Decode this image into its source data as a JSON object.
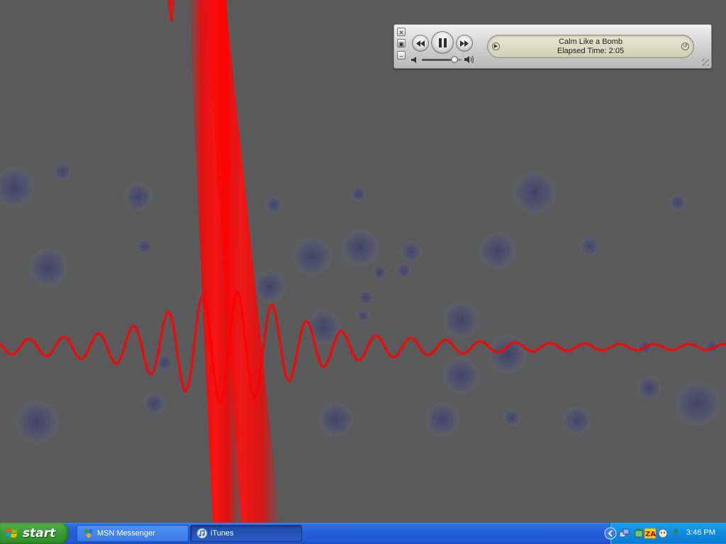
{
  "player": {
    "track_title": "Calm Like a Bomb",
    "elapsed_text": "Elapsed Time: 2:05",
    "volume_level": 0.82,
    "window_buttons": {
      "close": "close-icon",
      "zoom": "zoom-icon",
      "minimize": "minimize-icon"
    },
    "controls": {
      "previous": "rewind-icon",
      "play_pause": "pause-icon",
      "next": "fast-forward-icon"
    }
  },
  "taskbar": {
    "start_label": "start",
    "tasks": [
      {
        "label": "MSN Messenger",
        "icon": "msn-icon"
      },
      {
        "label": "iTunes",
        "icon": "itunes-icon",
        "active": true
      }
    ],
    "tray_icons": [
      "show-hidden-icons-chevron",
      "network-icon",
      "sound-icon",
      "zonealarm-icon",
      "messenger-tray-icon",
      "user-icon"
    ],
    "clock": "3:46 PM"
  },
  "colors": {
    "desktop": "#5a5a5a",
    "wave": "#ff0000",
    "bubbles": "#4a4d70",
    "taskbar": "#245edb",
    "start": "#3c9c36",
    "tray": "#0f8ae0"
  }
}
